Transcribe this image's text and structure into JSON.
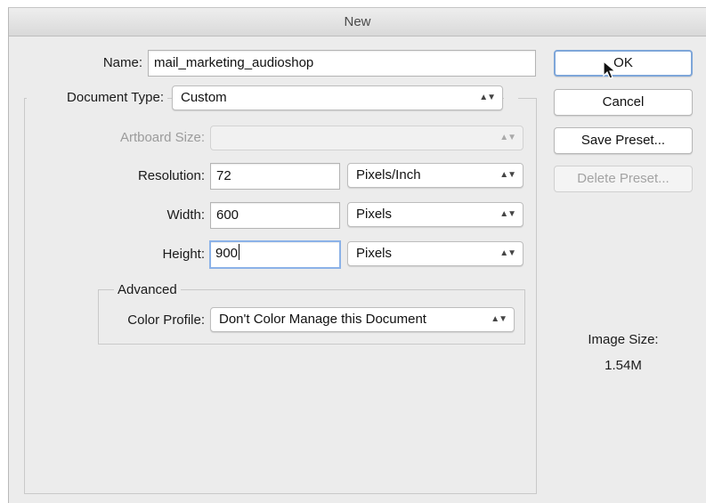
{
  "window": {
    "title": "New"
  },
  "form": {
    "name_label": "Name:",
    "name_value": "mail_marketing_audioshop",
    "document_type_label": "Document Type:",
    "document_type_value": "Custom",
    "artboard_size_label": "Artboard Size:",
    "artboard_size_value": "",
    "resolution_label": "Resolution:",
    "resolution_value": "72",
    "resolution_unit": "Pixels/Inch",
    "width_label": "Width:",
    "width_value": "600",
    "width_unit": "Pixels",
    "height_label": "Height:",
    "height_value": "900",
    "height_unit": "Pixels"
  },
  "advanced": {
    "legend": "Advanced",
    "color_profile_label": "Color Profile:",
    "color_profile_value": "Don't Color Manage this Document"
  },
  "buttons": {
    "ok": "OK",
    "cancel": "Cancel",
    "save_preset": "Save Preset...",
    "delete_preset": "Delete Preset..."
  },
  "image_size": {
    "label": "Image Size:",
    "value": "1.54M"
  },
  "icons": {
    "select_arrows": "updown-arrows-icon",
    "cursor": "mouse-pointer-icon"
  },
  "colors": {
    "focus_ring": "#8bb2e8",
    "dialog_bg": "#ececec",
    "default_button_ring": "#7ea6d9"
  }
}
